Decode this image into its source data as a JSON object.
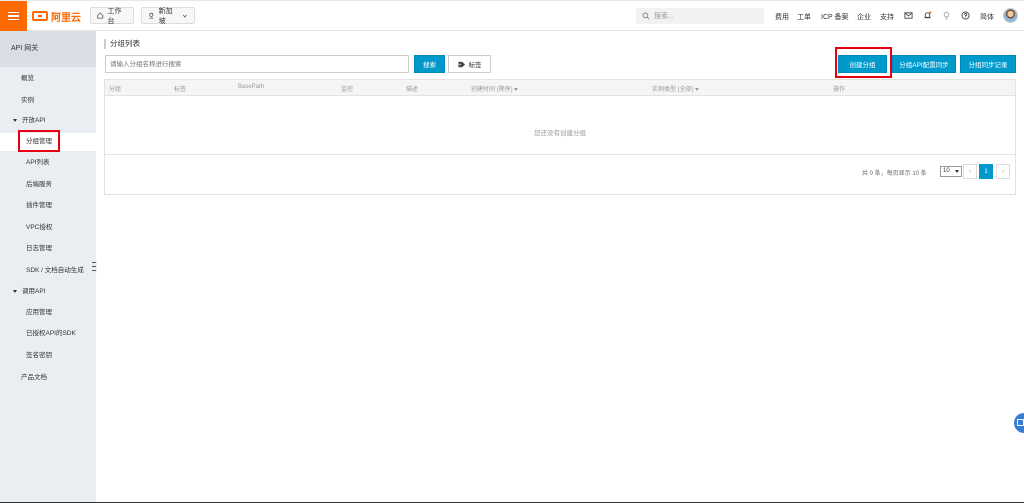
{
  "topbar": {
    "logo_text": "阿里云",
    "workbench_label": "工作台",
    "region_label": "新加坡",
    "search_placeholder": "搜索...",
    "links": [
      "费用",
      "工单",
      "ICP 备案",
      "企业",
      "支持"
    ],
    "language_label": "简体",
    "brand_color": "#ff6a00"
  },
  "sidebar": {
    "title": "API 网关",
    "items": [
      {
        "label": "概览"
      },
      {
        "label": "实例"
      },
      {
        "label": "开放API"
      },
      {
        "label": "分组管理"
      },
      {
        "label": "API列表"
      },
      {
        "label": "后端服务"
      },
      {
        "label": "插件管理"
      },
      {
        "label": "VPC授权"
      },
      {
        "label": "日志管理"
      },
      {
        "label": "SDK / 文档自动生成"
      },
      {
        "label": "调用API"
      },
      {
        "label": "应用管理"
      },
      {
        "label": "已授权API的SDK"
      },
      {
        "label": "签名密钥"
      },
      {
        "label": "产品文档"
      }
    ]
  },
  "main": {
    "page_title": "分组列表",
    "search_placeholder": "请输入分组名称进行搜索",
    "search_button": "搜索",
    "tag_button": "标签",
    "create_button": "创建分组",
    "sync_button": "分组API配置同步",
    "sync_log_button": "分组同步记录",
    "accent_color": "#0099cc",
    "table": {
      "columns": [
        "分组",
        "标签",
        "BasePath",
        "监控",
        "描述",
        "创建时间 (降序)",
        "实例类型 (全部)",
        "操作"
      ],
      "empty_text": "您还没有创建分组"
    },
    "pagination": {
      "summary": "共 0 条，每页显示 10 条",
      "page_size": "10",
      "prev": "‹",
      "current": "1",
      "next": "›"
    }
  }
}
